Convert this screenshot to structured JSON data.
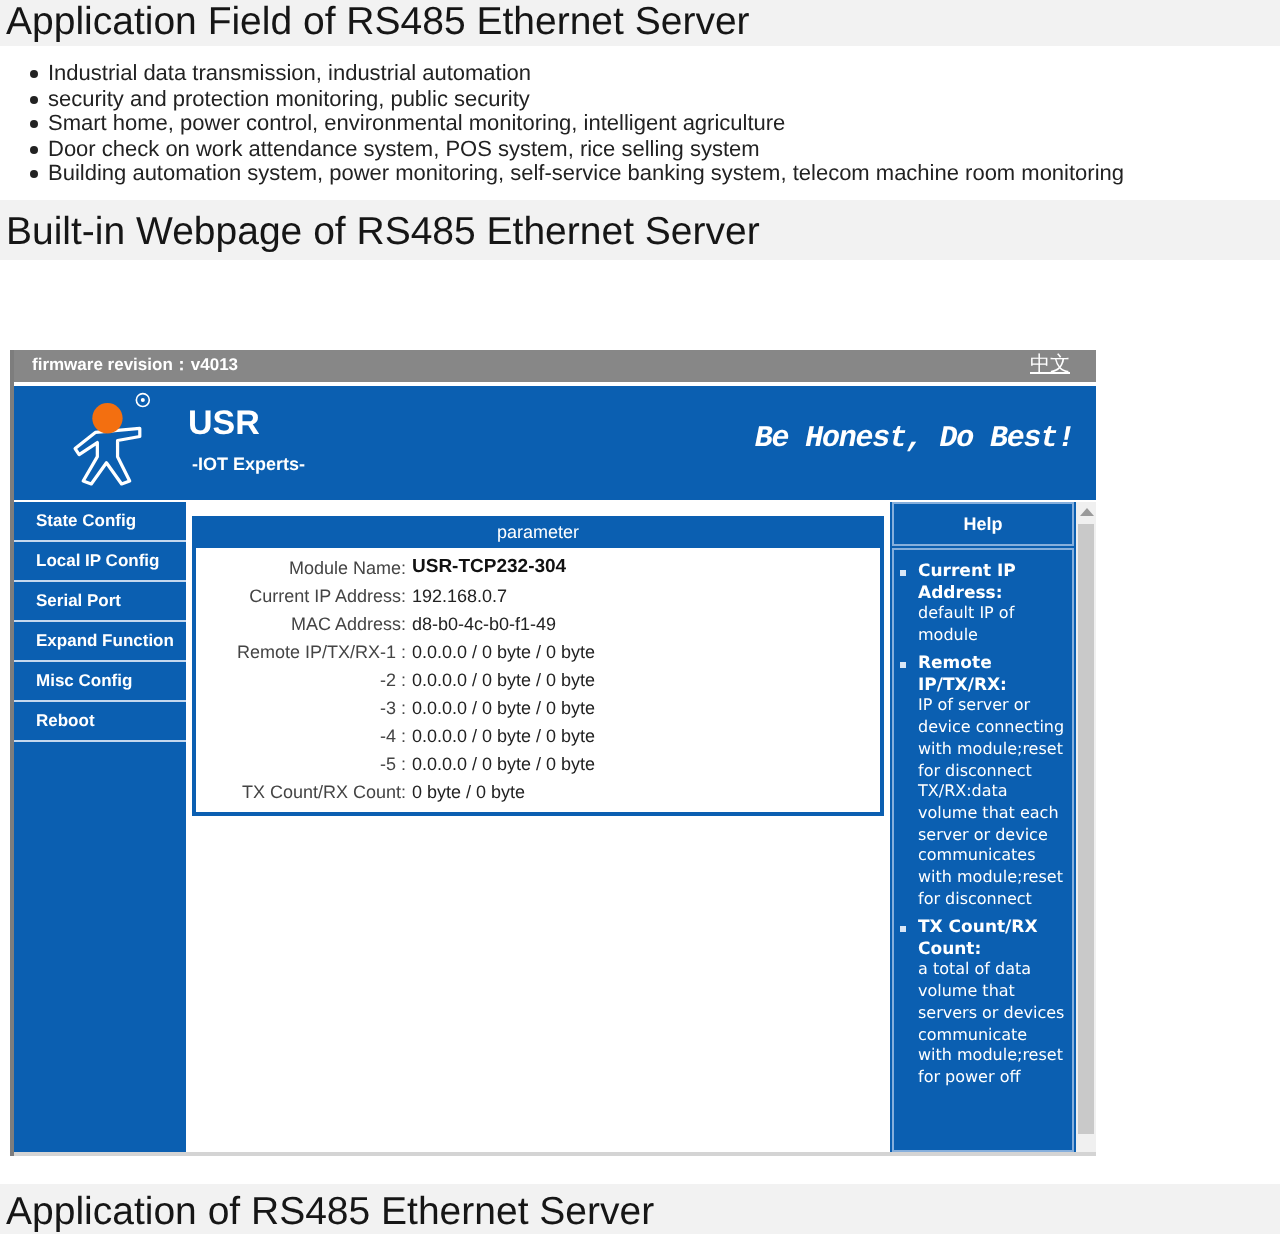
{
  "application_field": {
    "heading": "Application Field of RS485 Ethernet Server",
    "items": [
      "Industrial data transmission, industrial automation",
      "security and protection monitoring, public security",
      "Smart home, power control, environmental monitoring, intelligent agriculture",
      "Door check on work attendance system, POS system, rice selling system",
      "Building automation system, power monitoring, self-service banking system, telecom machine room monitoring"
    ]
  },
  "builtin_webpage": {
    "heading": "Built-in Webpage of RS485 Ethernet Server",
    "webpage": {
      "top_bar": {
        "firmware": "firmware revision：v4013",
        "language_link": "中文"
      },
      "banner": {
        "brand": "USR",
        "tagline": "-IOT Experts-",
        "slogan": "Be Honest, Do Best!"
      },
      "menu": [
        "State Config",
        "Local IP Config",
        "Serial Port",
        "Expand Function",
        "Misc Config",
        "Reboot"
      ],
      "parameter_panel": {
        "title": "parameter",
        "rows": [
          {
            "kind": "highlight",
            "label": "Module Name:",
            "value": "USR-TCP232-304"
          },
          {
            "kind": "plain",
            "label": "Current IP Address:",
            "value": "192.168.0.7"
          },
          {
            "kind": "plain",
            "label": "MAC Address:",
            "value": "d8-b0-4c-b0-f1-49"
          },
          {
            "kind": "plain",
            "label": "Remote IP/TX/RX-1 :",
            "value": "0.0.0.0 / 0 byte / 0 byte"
          },
          {
            "kind": "plain",
            "label": "-2 :",
            "value": "0.0.0.0 / 0 byte / 0 byte"
          },
          {
            "kind": "plain",
            "label": "-3 :",
            "value": "0.0.0.0 / 0 byte / 0 byte"
          },
          {
            "kind": "plain",
            "label": "-4 :",
            "value": "0.0.0.0 / 0 byte / 0 byte"
          },
          {
            "kind": "plain",
            "label": "-5 :",
            "value": "0.0.0.0 / 0 byte / 0 byte"
          },
          {
            "kind": "plain",
            "label": "TX Count/RX Count:",
            "value": "0 byte / 0 byte"
          }
        ]
      },
      "help": {
        "title": "Help",
        "items": [
          {
            "term": "Current IP Address:",
            "text": "default IP of module"
          },
          {
            "term": "Remote IP/TX/RX:",
            "text": "IP of server or device connecting with module;reset for disconnect TX/RX:data volume that each server or device communicates with module;reset for disconnect"
          },
          {
            "term": "TX Count/RX Count:",
            "text": "a total of data volume that servers or devices communicate with module;reset for power off"
          }
        ]
      }
    }
  },
  "application": {
    "heading": "Application of RS485 Ethernet Server"
  }
}
